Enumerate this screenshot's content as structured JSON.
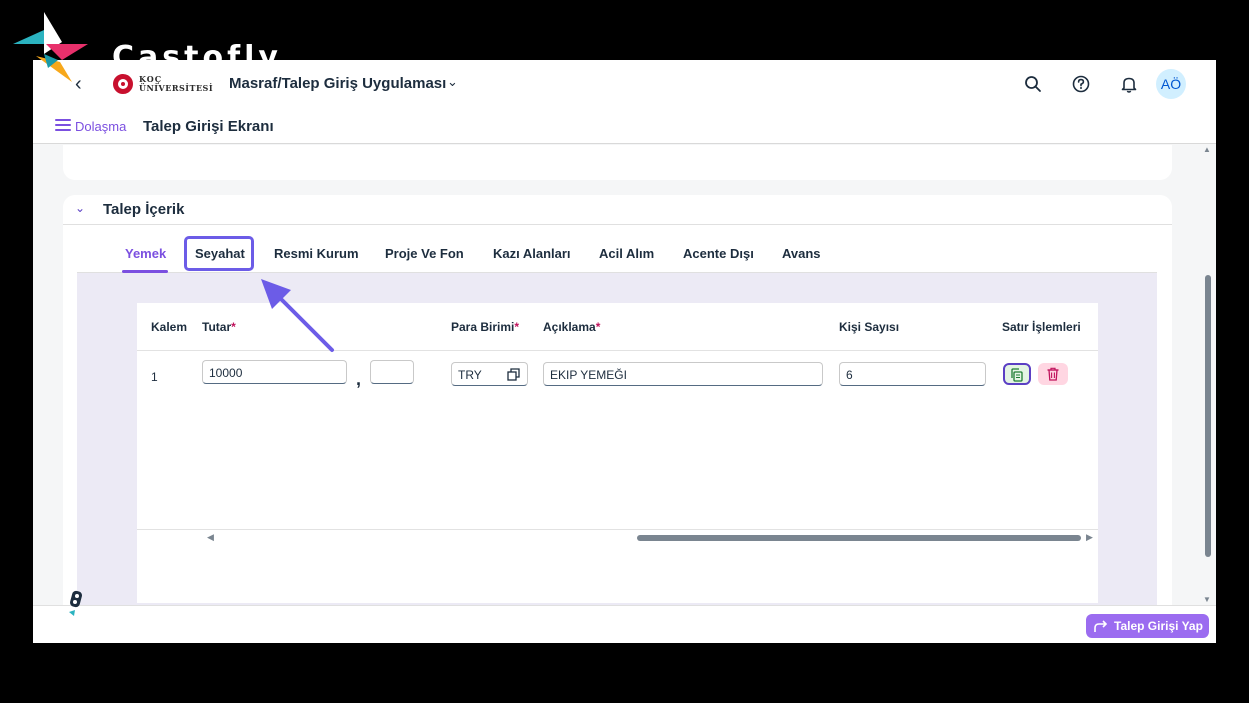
{
  "watermark": {
    "brand": "Castofly"
  },
  "shellbar": {
    "logo_line1": "KOÇ",
    "logo_line2": "ÜNİVERSİTESİ",
    "app_title": "Masraf/Talep Giriş Uygulaması",
    "avatar_initials": "AÖ"
  },
  "subheader": {
    "nav_label": "Dolaşma",
    "page_title": "Talep Girişi Ekranı"
  },
  "section": {
    "title": "Talep İçerik",
    "tabs": [
      {
        "label": "Yemek",
        "active": true
      },
      {
        "label": "Seyahat",
        "highlighted": true
      },
      {
        "label": "Resmi Kurum"
      },
      {
        "label": "Proje Ve Fon"
      },
      {
        "label": "Kazı Alanları"
      },
      {
        "label": "Acil Alım"
      },
      {
        "label": "Acente Dışı"
      },
      {
        "label": "Avans"
      }
    ]
  },
  "table": {
    "headers": {
      "kalem": "Kalem",
      "tutar": "Tutar",
      "para_birimi": "Para Birimi",
      "aciklama": "Açıklama",
      "kisi_sayisi": "Kişi Sayısı",
      "satir_islemleri": "Satır İşlemleri"
    },
    "required_mark": "*",
    "rows": [
      {
        "kalem": "1",
        "tutar": "10000",
        "decimal_separator": ",",
        "tutar_decimal": "",
        "para_birimi": "TRY",
        "aciklama": "EKIP YEMEĞI",
        "kisi_sayisi": "6"
      }
    ]
  },
  "footer": {
    "submit_label": "Talep Girişi Yap"
  },
  "colors": {
    "accent": "#7b4fe0",
    "highlight_box": "#6c5ce7",
    "submit": "#9b6cf0"
  }
}
